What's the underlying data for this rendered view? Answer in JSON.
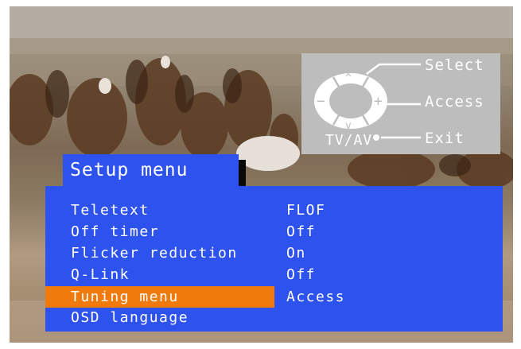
{
  "help_panel": {
    "select_label": "Select",
    "access_label": "Access",
    "exit_label": "Exit",
    "tvav_label": "TV/AV"
  },
  "menu": {
    "title": "Setup menu",
    "items": [
      {
        "label": "Teletext",
        "value": "FLOF"
      },
      {
        "label": "Off timer",
        "value": "Off"
      },
      {
        "label": "Flicker reduction",
        "value": "On"
      },
      {
        "label": "Q-Link",
        "value": "Off"
      },
      {
        "label": "Tuning menu",
        "value": "Access"
      },
      {
        "label": "OSD language",
        "value": ""
      }
    ],
    "selected_index": 4
  },
  "colors": {
    "menu_blue": "#2e52ee",
    "highlight_orange": "#f07a0c",
    "help_grey": "#bdbdbd"
  }
}
